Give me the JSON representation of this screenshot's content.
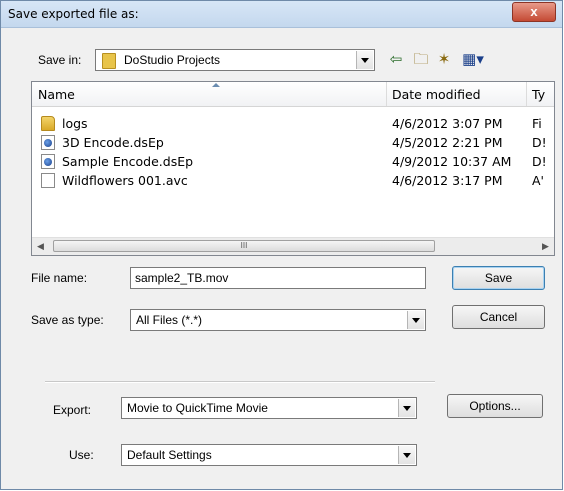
{
  "window": {
    "title": "Save exported file as:",
    "close_label": "x"
  },
  "save_in": {
    "label": "Save in:",
    "value": "DoStudio Projects"
  },
  "toolbar": {
    "icons": [
      "back-arrow-icon",
      "up-folder-icon",
      "new-folder-icon",
      "view-menu-icon"
    ]
  },
  "file_list": {
    "columns": [
      "Name",
      "Date modified",
      "Ty"
    ],
    "rows": [
      {
        "icon": "folder-icon",
        "name": "logs",
        "date": "4/6/2012 3:07 PM",
        "type": "Fi"
      },
      {
        "icon": "dsep-file-icon",
        "name": "3D Encode.dsEp",
        "date": "4/5/2012 2:21 PM",
        "type": "D!"
      },
      {
        "icon": "dsep-file-icon",
        "name": "Sample Encode.dsEp",
        "date": "4/9/2012 10:37 AM",
        "type": "D!"
      },
      {
        "icon": "blank-file-icon",
        "name": "Wildflowers 001.avc",
        "date": "4/6/2012 3:17 PM",
        "type": "A'"
      }
    ],
    "scrollbar_thumb": "III"
  },
  "file_name": {
    "label": "File name:",
    "value": "sample2_TB.mov"
  },
  "save_as_type": {
    "label": "Save as type:",
    "value": "All Files (*.*)"
  },
  "buttons": {
    "save": "Save",
    "cancel": "Cancel",
    "options": "Options..."
  },
  "export": {
    "label": "Export:",
    "value": "Movie to QuickTime Movie"
  },
  "use": {
    "label": "Use:",
    "value": "Default Settings"
  }
}
